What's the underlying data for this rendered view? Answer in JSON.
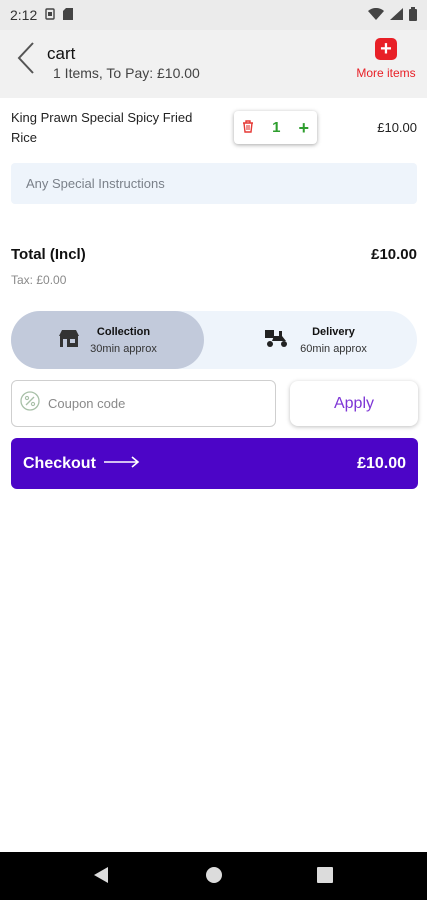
{
  "status_bar": {
    "time": "2:12"
  },
  "header": {
    "title": "cart",
    "subtitle": "1 Items, To Pay: £10.00",
    "more_items_label": "More items"
  },
  "cart_items": [
    {
      "name": "King Prawn Special Spicy Fried Rice",
      "quantity": "1",
      "price": "£10.00"
    }
  ],
  "instructions": {
    "placeholder": "Any Special Instructions"
  },
  "totals": {
    "label": "Total (Incl)",
    "value": "£10.00",
    "tax": "Tax: £0.00"
  },
  "order_modes": [
    {
      "title": "Collection",
      "time": "30min approx",
      "selected": true
    },
    {
      "title": "Delivery",
      "time": "60min approx",
      "selected": false
    }
  ],
  "coupon": {
    "placeholder": "Coupon code",
    "apply_label": "Apply"
  },
  "checkout": {
    "label": "Checkout",
    "total": "£10.00"
  },
  "colors": {
    "brand_purple": "#4c05c7",
    "apply_purple": "#7e36d6",
    "accent_red": "#e82027",
    "qty_green": "#2e9e2e",
    "selected_mode": "#c2cadb",
    "soft_blue": "#eef4fb"
  },
  "icons": {
    "back": "chevron-left-icon",
    "more_items": "plus-square-icon",
    "delete": "trash-icon",
    "increment": "plus-icon",
    "collection": "store-icon",
    "delivery": "delivery-scooter-icon",
    "coupon": "percent-icon",
    "checkout_arrow": "arrow-right-icon"
  }
}
